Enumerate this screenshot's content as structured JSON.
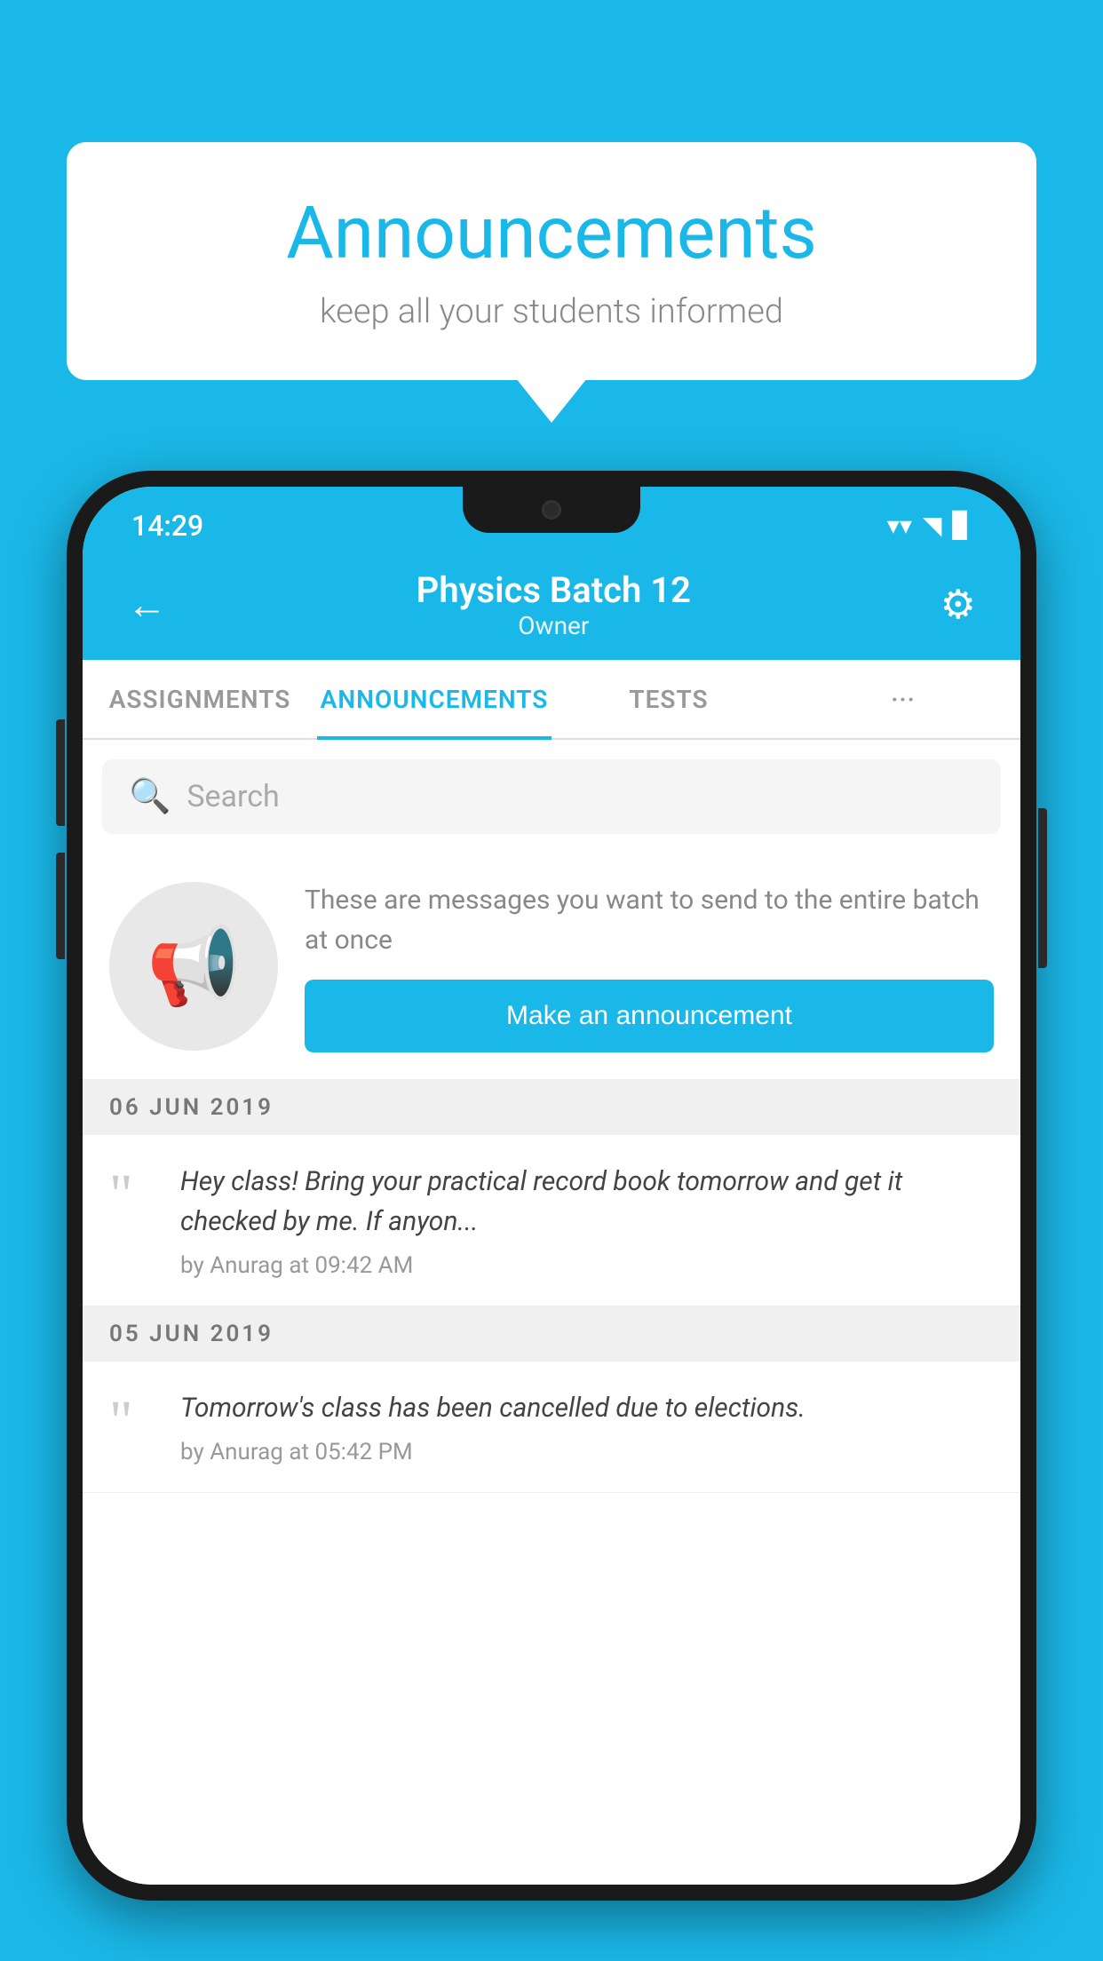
{
  "background_color": "#1ab8e8",
  "speech_bubble": {
    "title": "Announcements",
    "subtitle": "keep all your students informed"
  },
  "status_bar": {
    "time": "14:29",
    "wifi": "▼",
    "signal": "▲",
    "battery": "▌"
  },
  "app_bar": {
    "back_label": "←",
    "title": "Physics Batch 12",
    "subtitle": "Owner",
    "gear_label": "⚙"
  },
  "tabs": [
    {
      "label": "ASSIGNMENTS",
      "active": false
    },
    {
      "label": "ANNOUNCEMENTS",
      "active": true
    },
    {
      "label": "TESTS",
      "active": false
    },
    {
      "label": "···",
      "active": false
    }
  ],
  "search": {
    "placeholder": "Search"
  },
  "promo": {
    "description": "These are messages you want to send to the entire batch at once",
    "button_label": "Make an announcement"
  },
  "announcements": [
    {
      "date": "06  JUN  2019",
      "text": "Hey class! Bring your practical record book tomorrow and get it checked by me. If anyon...",
      "meta": "by Anurag at 09:42 AM"
    },
    {
      "date": "05  JUN  2019",
      "text": "Tomorrow's class has been cancelled due to elections.",
      "meta": "by Anurag at 05:42 PM"
    }
  ]
}
